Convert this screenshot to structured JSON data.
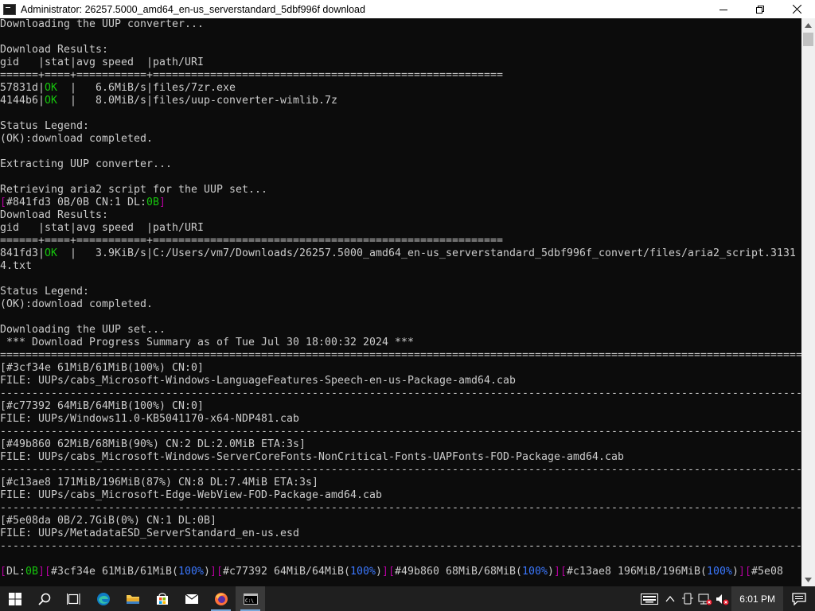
{
  "window": {
    "title": "Administrator:  26257.5000_amd64_en-us_serverstandard_5dbf996f download",
    "controls": {
      "minimize": "—",
      "maximize": "❐",
      "close": "✕"
    }
  },
  "console": {
    "lines": [
      [
        {
          "t": "Downloading the UUP converter..."
        }
      ],
      [
        {
          "t": ""
        }
      ],
      [
        {
          "t": "Download Results:"
        }
      ],
      [
        {
          "t": "gid   |stat|avg speed  |path/URI"
        }
      ],
      [
        {
          "t": "======+====+===========+======================================================="
        }
      ],
      [
        {
          "t": "57831d|"
        },
        {
          "t": "OK",
          "c": "g"
        },
        {
          "t": "  |   6.6MiB/s|files/7zr.exe"
        }
      ],
      [
        {
          "t": "4144b6|"
        },
        {
          "t": "OK",
          "c": "g"
        },
        {
          "t": "  |   8.0MiB/s|files/uup-converter-wimlib.7z"
        }
      ],
      [
        {
          "t": ""
        }
      ],
      [
        {
          "t": "Status Legend:"
        }
      ],
      [
        {
          "t": "(OK):download completed."
        }
      ],
      [
        {
          "t": ""
        }
      ],
      [
        {
          "t": "Extracting UUP converter..."
        }
      ],
      [
        {
          "t": ""
        }
      ],
      [
        {
          "t": "Retrieving aria2 script for the UUP set..."
        }
      ],
      [
        {
          "t": "[",
          "c": "m"
        },
        {
          "t": "#841fd3 0B/0B CN:1 DL:"
        },
        {
          "t": "0B",
          "c": "g"
        },
        {
          "t": "]",
          "c": "m"
        }
      ],
      [
        {
          "t": "Download Results:"
        }
      ],
      [
        {
          "t": "gid   |stat|avg speed  |path/URI"
        }
      ],
      [
        {
          "t": "======+====+===========+======================================================="
        }
      ],
      [
        {
          "t": "841fd3|"
        },
        {
          "t": "OK",
          "c": "g"
        },
        {
          "t": "  |   3.9KiB/s|C:/Users/vm7/Downloads/26257.5000_amd64_en-us_serverstandard_5dbf996f_convert/files/aria2_script.3131"
        }
      ],
      [
        {
          "t": "4.txt"
        }
      ],
      [
        {
          "t": ""
        }
      ],
      [
        {
          "t": "Status Legend:"
        }
      ],
      [
        {
          "t": "(OK):download completed."
        }
      ],
      [
        {
          "t": ""
        }
      ],
      [
        {
          "t": "Downloading the UUP set..."
        }
      ],
      [
        {
          "t": " *** Download Progress Summary as of Tue Jul 30 18:00:32 2024 ***"
        }
      ],
      [
        {
          "t": "==============================================================================================================================="
        }
      ],
      [
        {
          "t": "[#3cf34e 61MiB/61MiB(100%) CN:0]"
        }
      ],
      [
        {
          "t": "FILE: UUPs/cabs_Microsoft-Windows-LanguageFeatures-Speech-en-us-Package-amd64.cab"
        }
      ],
      [
        {
          "t": "-------------------------------------------------------------------------------------------------------------------------------"
        }
      ],
      [
        {
          "t": "[#c77392 64MiB/64MiB(100%) CN:0]"
        }
      ],
      [
        {
          "t": "FILE: UUPs/Windows11.0-KB5041170-x64-NDP481.cab"
        }
      ],
      [
        {
          "t": "-------------------------------------------------------------------------------------------------------------------------------"
        }
      ],
      [
        {
          "t": "[#49b860 62MiB/68MiB(90%) CN:2 DL:2.0MiB ETA:3s]"
        }
      ],
      [
        {
          "t": "FILE: UUPs/cabs_Microsoft-Windows-ServerCoreFonts-NonCritical-Fonts-UAPFonts-FOD-Package-amd64.cab"
        }
      ],
      [
        {
          "t": "-------------------------------------------------------------------------------------------------------------------------------"
        }
      ],
      [
        {
          "t": "[#c13ae8 171MiB/196MiB(87%) CN:8 DL:7.4MiB ETA:3s]"
        }
      ],
      [
        {
          "t": "FILE: UUPs/cabs_Microsoft-Edge-WebView-FOD-Package-amd64.cab"
        }
      ],
      [
        {
          "t": "-------------------------------------------------------------------------------------------------------------------------------"
        }
      ],
      [
        {
          "t": "[#5e08da 0B/2.7GiB(0%) CN:1 DL:0B]"
        }
      ],
      [
        {
          "t": "FILE: UUPs/MetadataESD_ServerStandard_en-us.esd"
        }
      ],
      [
        {
          "t": "-------------------------------------------------------------------------------------------------------------------------------"
        }
      ],
      [
        {
          "t": ""
        }
      ],
      [
        {
          "t": "[",
          "c": "m"
        },
        {
          "t": "DL:"
        },
        {
          "t": "0B",
          "c": "g"
        },
        {
          "t": "][",
          "c": "m"
        },
        {
          "t": "#3cf34e 61MiB/61MiB("
        },
        {
          "t": "100%",
          "c": "c"
        },
        {
          "t": ")"
        },
        {
          "t": "][",
          "c": "m"
        },
        {
          "t": "#c77392 64MiB/64MiB("
        },
        {
          "t": "100%",
          "c": "c"
        },
        {
          "t": ")"
        },
        {
          "t": "][",
          "c": "m"
        },
        {
          "t": "#49b860 68MiB/68MiB("
        },
        {
          "t": "100%",
          "c": "c"
        },
        {
          "t": ")"
        },
        {
          "t": "][",
          "c": "m"
        },
        {
          "t": "#c13ae8 196MiB/196MiB("
        },
        {
          "t": "100%",
          "c": "c"
        },
        {
          "t": ")"
        },
        {
          "t": "][",
          "c": "m"
        },
        {
          "t": "#5e08"
        }
      ]
    ]
  },
  "scrollbar": {
    "position": 0.0
  },
  "taskbar": {
    "items": [
      {
        "name": "start-button",
        "icon": "windows-logo-icon"
      },
      {
        "name": "search-button",
        "icon": "search-icon"
      },
      {
        "name": "task-view-button",
        "icon": "task-view-icon"
      },
      {
        "name": "edge-button",
        "icon": "edge-icon"
      },
      {
        "name": "file-explorer-button",
        "icon": "folder-icon"
      },
      {
        "name": "store-button",
        "icon": "store-icon"
      },
      {
        "name": "mail-button",
        "icon": "mail-icon"
      },
      {
        "name": "firefox-button",
        "icon": "firefox-icon"
      },
      {
        "name": "cmd-button",
        "icon": "console-icon"
      }
    ],
    "clock": "6:01 PM"
  }
}
